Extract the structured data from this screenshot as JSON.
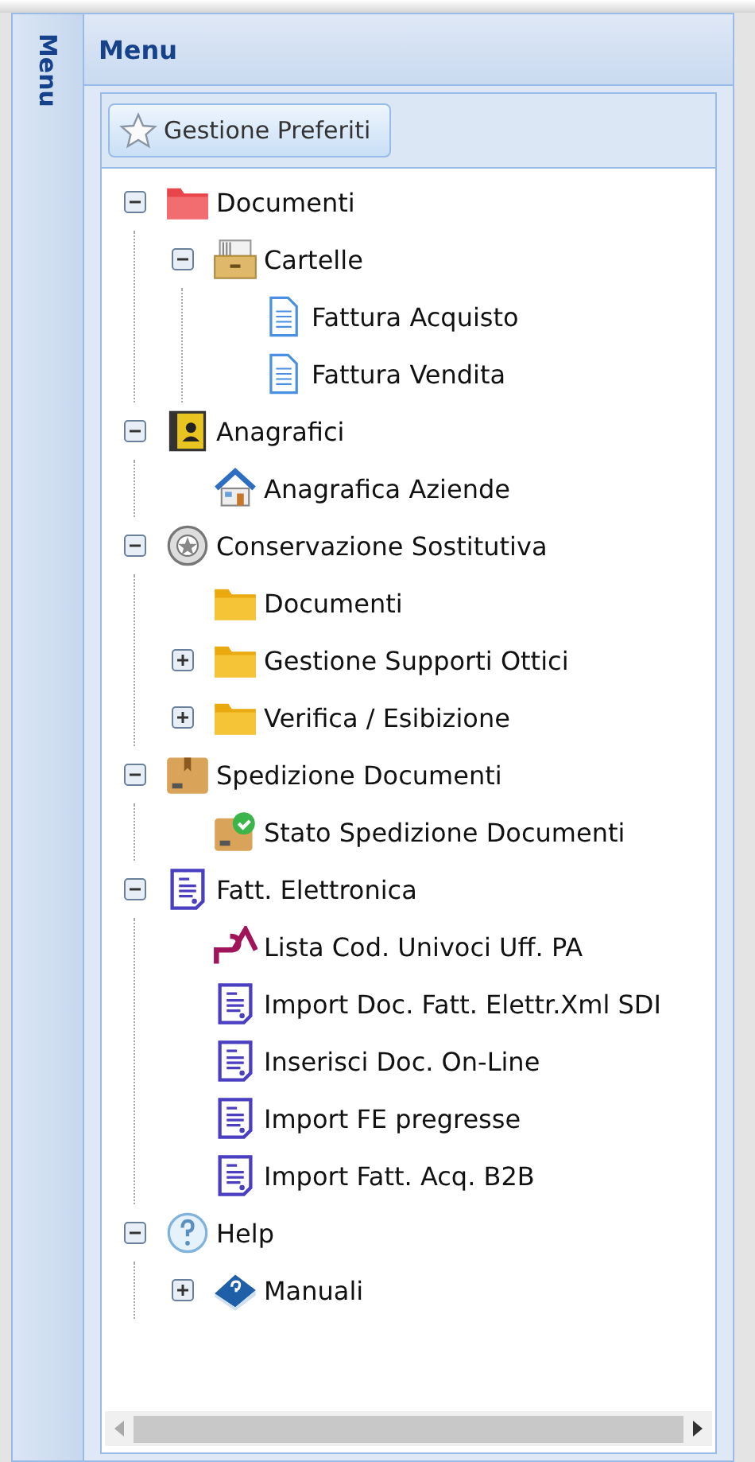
{
  "side_strip": {
    "title": "Menu"
  },
  "panel": {
    "title": "Menu",
    "toolbar_button": "Gestione Preferiti",
    "tree": [
      {
        "label": "Documenti",
        "kind": "folder-red",
        "expanded": true,
        "children": [
          {
            "label": "Cartelle",
            "kind": "drawer",
            "expanded": true,
            "children": [
              {
                "label": "Fattura Acquisto",
                "kind": "document"
              },
              {
                "label": "Fattura Vendita",
                "kind": "document"
              }
            ]
          }
        ]
      },
      {
        "label": "Anagrafici",
        "kind": "contact",
        "expanded": true,
        "children": [
          {
            "label": "Anagrafica Aziende",
            "kind": "house"
          }
        ]
      },
      {
        "label": "Conservazione Sostitutiva",
        "kind": "seal",
        "expanded": true,
        "children": [
          {
            "label": "Documenti",
            "kind": "folder"
          },
          {
            "label": "Gestione Supporti Ottici",
            "kind": "folder",
            "expanded": false
          },
          {
            "label": "Verifica / Esibizione",
            "kind": "folder",
            "expanded": false
          }
        ]
      },
      {
        "label": "Spedizione Documenti",
        "kind": "box",
        "expanded": true,
        "children": [
          {
            "label": "Stato Spedizione Documenti",
            "kind": "box-check"
          }
        ]
      },
      {
        "label": "Fatt. Elettronica",
        "kind": "invoice",
        "expanded": true,
        "children": [
          {
            "label": "Lista Cod. Univoci Uff. PA",
            "kind": "pa"
          },
          {
            "label": "Import Doc. Fatt. Elettr.Xml SDI",
            "kind": "invoice"
          },
          {
            "label": "Inserisci Doc. On-Line",
            "kind": "invoice"
          },
          {
            "label": "Import FE pregresse",
            "kind": "invoice"
          },
          {
            "label": "Import Fatt. Acq. B2B",
            "kind": "invoice"
          }
        ]
      },
      {
        "label": "Help",
        "kind": "help",
        "expanded": true,
        "children": [
          {
            "label": "Manuali",
            "kind": "book",
            "expanded": false
          }
        ]
      }
    ]
  }
}
